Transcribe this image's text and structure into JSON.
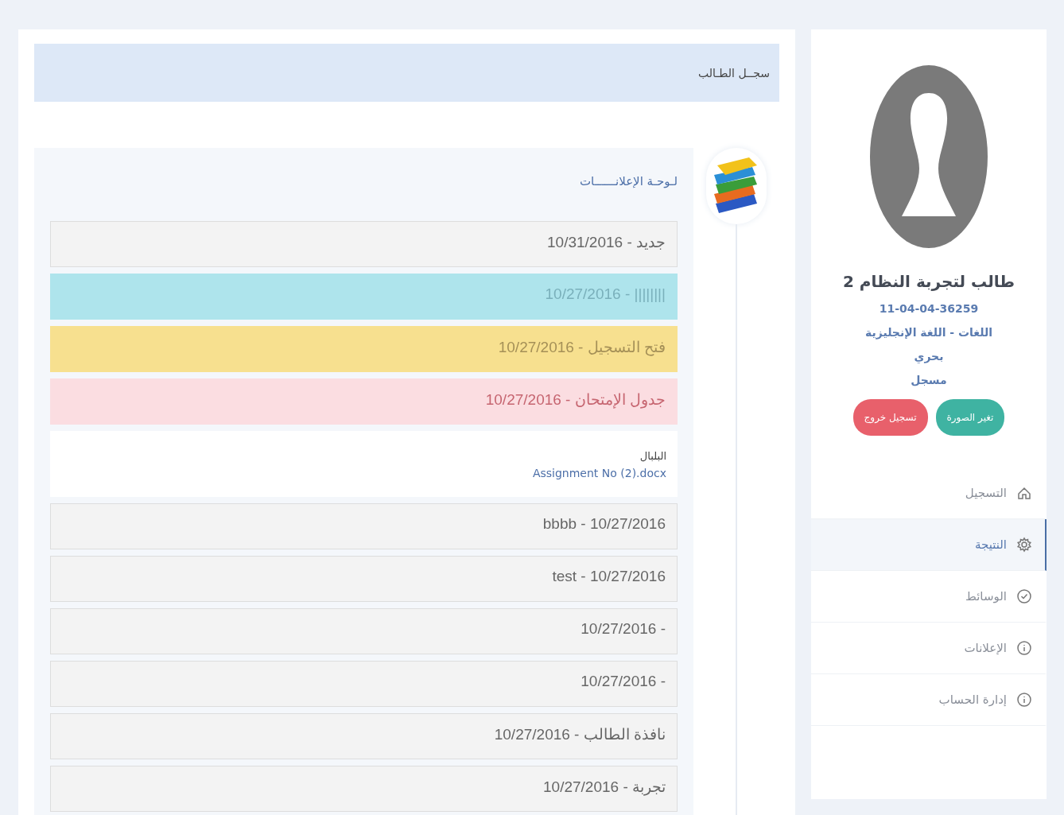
{
  "profile": {
    "name": "طالب لتجربة النظام 2",
    "student_id": "11-04-04-36259",
    "department": "اللغات - اللغة الإنجليزية",
    "branch": "بحري",
    "status": "مسجل",
    "buttons": [
      {
        "label": "تغير الصورة",
        "kind": "primary"
      },
      {
        "label": "تسجيل خروج",
        "kind": "danger"
      }
    ]
  },
  "nav": [
    {
      "label": "التسجيل",
      "kind": "home",
      "selected": false
    },
    {
      "label": "النتيجة",
      "kind": "settings",
      "selected": true
    },
    {
      "label": "الوسائط",
      "kind": "media",
      "selected": false
    },
    {
      "label": "الإعلانات",
      "kind": "announcements",
      "selected": false
    },
    {
      "label": "إدارة الحساب",
      "kind": "account",
      "selected": false
    }
  ],
  "page_title": "سجــل الطـالب",
  "board": {
    "title": "لـوحـة الإعلانــــــات",
    "items": [
      {
        "kind": "default",
        "text": "10/31/2016 - جديد"
      },
      {
        "kind": "info",
        "text": "10/27/2016 - ||||||||"
      },
      {
        "kind": "warning",
        "text": "10/27/2016 - فتح التسجيل"
      },
      {
        "kind": "danger",
        "text": "10/27/2016 - جدول الإمتحان"
      },
      {
        "kind": "attachment",
        "text": "البلبال",
        "link": "Assignment No (2).docx"
      },
      {
        "kind": "default",
        "text": "bbbb - 10/27/2016"
      },
      {
        "kind": "default",
        "text": "test - 10/27/2016"
      },
      {
        "kind": "default",
        "text": "10/27/2016 -"
      },
      {
        "kind": "default",
        "text": "10/27/2016 -"
      },
      {
        "kind": "default",
        "text": "10/27/2016 - نافذة الطالب"
      },
      {
        "kind": "default",
        "text": "10/27/2016 - تجربة"
      }
    ]
  }
}
